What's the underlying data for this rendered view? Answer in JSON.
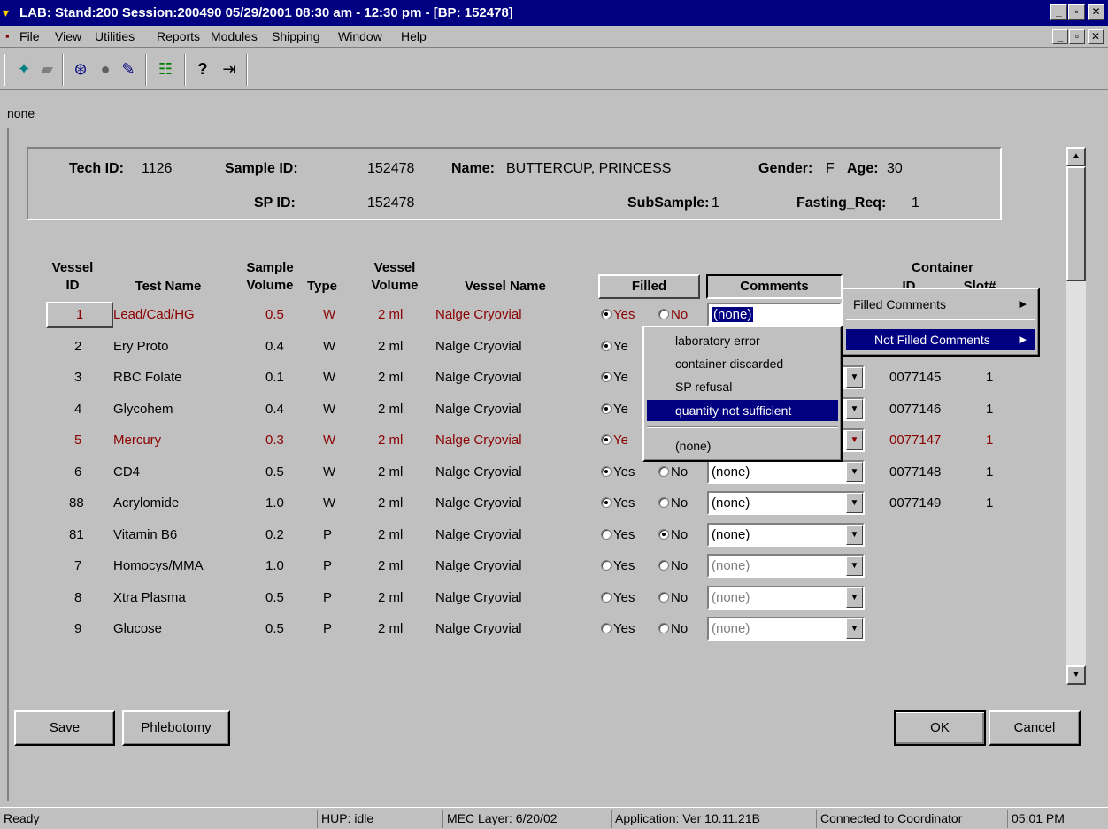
{
  "window": {
    "title": "LAB: Stand:200 Session:200490 05/29/2001 08:30 am - 12:30 pm - [BP: 152478]"
  },
  "menu": [
    "File",
    "View",
    "Utilities",
    "Reports",
    "Modules",
    "Shipping",
    "Window",
    "Help"
  ],
  "context_label": "none",
  "header": {
    "tech_id_label": "Tech ID:",
    "tech_id": "1126",
    "sample_id_label": "Sample ID:",
    "sample_id": "152478",
    "name_label": "Name:",
    "name": "BUTTERCUP, PRINCESS",
    "gender_label": "Gender:",
    "gender": "F",
    "age_label": "Age:",
    "age": "30",
    "sp_id_label": "SP ID:",
    "sp_id": "152478",
    "subsample_label": "SubSample:",
    "subsample": "1",
    "fasting_label": "Fasting_Req:",
    "fasting": "1"
  },
  "columns": {
    "vessel_id": "Vessel ID",
    "test_name": "Test Name",
    "sample_volume": "Sample Volume",
    "type": "Type",
    "vessel_volume": "Vessel Volume",
    "vessel_name": "Vessel Name",
    "filled": "Filled",
    "comments": "Comments",
    "container": "Container",
    "container_id": "ID",
    "slot": "Slot#"
  },
  "rows": [
    {
      "id": "1",
      "test": "Lead/Cad/HG",
      "vol": "0.5",
      "type": "W",
      "vvol": "2 ml",
      "vname": "Nalge Cryovial",
      "yes": "Yes",
      "no": "No",
      "comment": "(none)",
      "container": "",
      "slot": ""
    },
    {
      "id": "2",
      "test": "Ery Proto",
      "vol": "0.4",
      "type": "W",
      "vvol": "2 ml",
      "vname": "Nalge Cryovial",
      "yes": "Ye",
      "no": "",
      "comment": "",
      "container": "",
      "slot": ""
    },
    {
      "id": "3",
      "test": "RBC Folate",
      "vol": "0.1",
      "type": "W",
      "vvol": "2 ml",
      "vname": "Nalge Cryovial",
      "yes": "Ye",
      "no": "",
      "comment": "",
      "container": "0077145",
      "slot": "1"
    },
    {
      "id": "4",
      "test": "Glycohem",
      "vol": "0.4",
      "type": "W",
      "vvol": "2 ml",
      "vname": "Nalge Cryovial",
      "yes": "Ye",
      "no": "",
      "comment": "",
      "container": "0077146",
      "slot": "1"
    },
    {
      "id": "5",
      "test": "Mercury",
      "vol": "0.3",
      "type": "W",
      "vvol": "2 ml",
      "vname": "Nalge Cryovial",
      "yes": "Ye",
      "no": "",
      "comment": "",
      "container": "0077147",
      "slot": "1"
    },
    {
      "id": "6",
      "test": "CD4",
      "vol": "0.5",
      "type": "W",
      "vvol": "2 ml",
      "vname": "Nalge Cryovial",
      "yes": "Yes",
      "no": "No",
      "comment": "(none)",
      "container": "0077148",
      "slot": "1"
    },
    {
      "id": "88",
      "test": "Acrylomide",
      "vol": "1.0",
      "type": "W",
      "vvol": "2 ml",
      "vname": "Nalge Cryovial",
      "yes": "Yes",
      "no": "No",
      "comment": "(none)",
      "container": "0077149",
      "slot": "1"
    },
    {
      "id": "81",
      "test": "Vitamin B6",
      "vol": "0.2",
      "type": "P",
      "vvol": "2 ml",
      "vname": "Nalge Cryovial",
      "yes": "Yes",
      "no": "No",
      "comment": "(none)",
      "container": "",
      "slot": ""
    },
    {
      "id": "7",
      "test": "Homocys/MMA",
      "vol": "1.0",
      "type": "P",
      "vvol": "2 ml",
      "vname": "Nalge Cryovial",
      "yes": "Yes",
      "no": "No",
      "comment": "(none)",
      "container": "",
      "slot": ""
    },
    {
      "id": "8",
      "test": "Xtra Plasma",
      "vol": "0.5",
      "type": "P",
      "vvol": "2 ml",
      "vname": "Nalge Cryovial",
      "yes": "Yes",
      "no": "No",
      "comment": "(none)",
      "container": "",
      "slot": ""
    },
    {
      "id": "9",
      "test": "Glucose",
      "vol": "0.5",
      "type": "P",
      "vvol": "2 ml",
      "vname": "Nalge Cryovial",
      "yes": "Yes",
      "no": "No",
      "comment": "(none)",
      "container": "",
      "slot": ""
    }
  ],
  "context_menu": {
    "filled_comments": "Filled Comments",
    "not_filled_comments": "Not Filled Comments"
  },
  "submenu": [
    "laboratory error",
    "container discarded",
    "SP refusal",
    "quantity not sufficient",
    "(none)"
  ],
  "buttons": {
    "save": "Save",
    "phlebotomy": "Phlebotomy",
    "ok": "OK",
    "cancel": "Cancel"
  },
  "status": {
    "ready": "Ready",
    "hup": "HUP: idle",
    "mec": "MEC Layer: 6/20/02",
    "app": "Application: Ver 10.11.21B",
    "conn": "Connected to Coordinator",
    "time": "05:01 PM"
  }
}
